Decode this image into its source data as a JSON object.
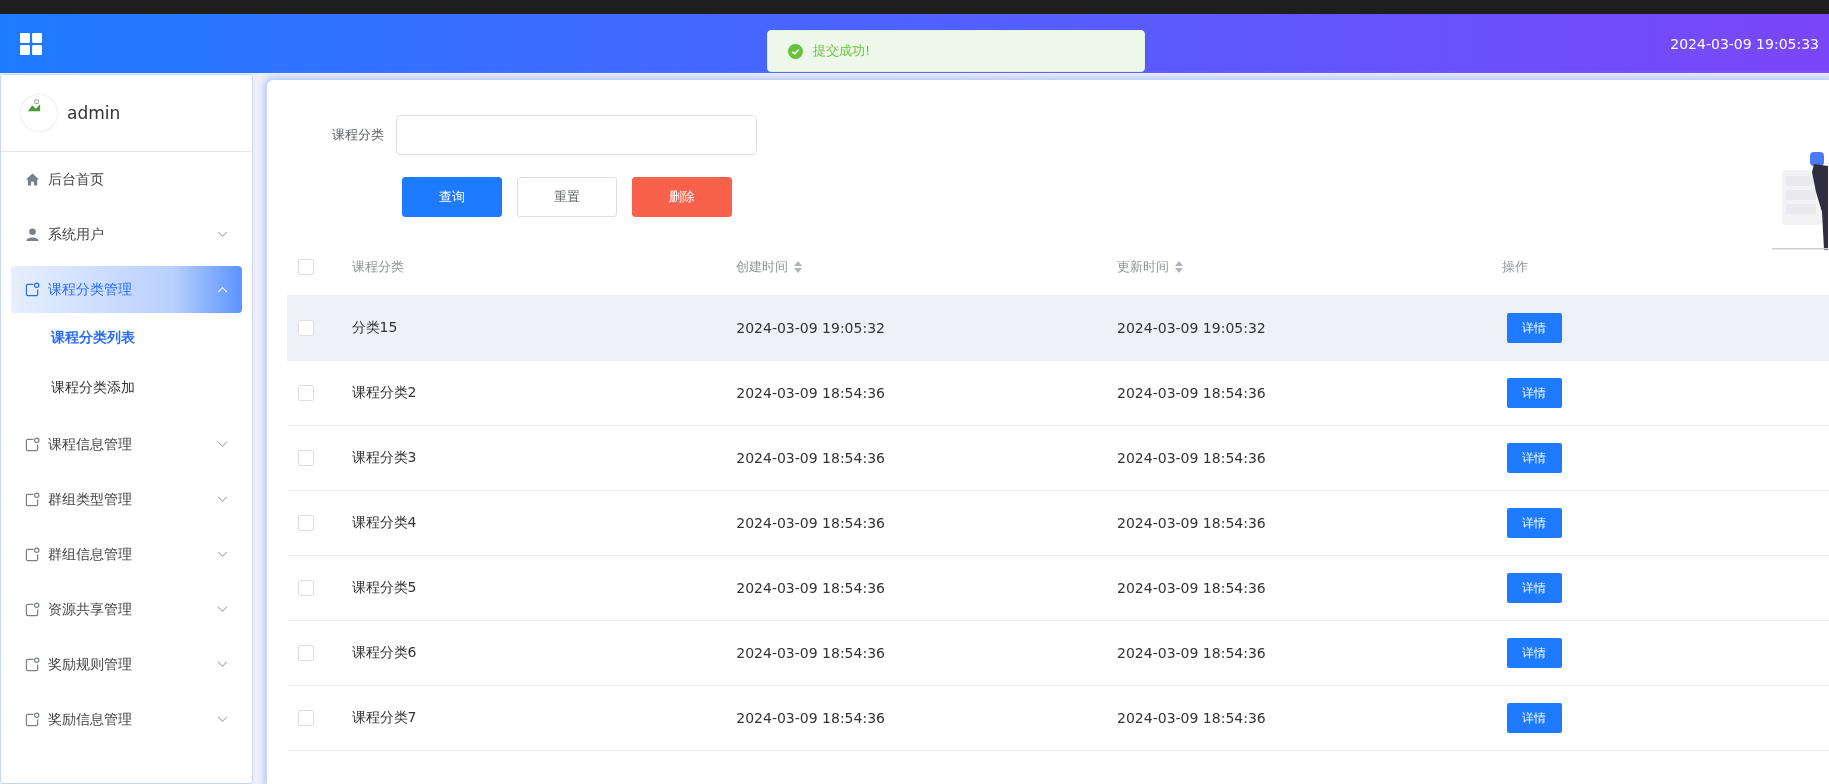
{
  "header": {
    "datetime": "2024-03-09 19:05:33"
  },
  "toast": {
    "kind": "success",
    "message": "提交成功!"
  },
  "user": {
    "name": "admin"
  },
  "sidebar": {
    "items": [
      {
        "kind": "home",
        "label": "后台首页",
        "selected": false
      },
      {
        "kind": "user",
        "label": "系统用户",
        "selected": false,
        "expanded": false
      },
      {
        "kind": "module",
        "label": "课程分类管理",
        "selected": true,
        "expanded": true,
        "children": [
          {
            "label": "课程分类列表",
            "selected": true
          },
          {
            "label": "课程分类添加",
            "selected": false
          }
        ]
      },
      {
        "kind": "module",
        "label": "课程信息管理",
        "selected": false,
        "expanded": false
      },
      {
        "kind": "module",
        "label": "群组类型管理",
        "selected": false,
        "expanded": false
      },
      {
        "kind": "module",
        "label": "群组信息管理",
        "selected": false,
        "expanded": false
      },
      {
        "kind": "module",
        "label": "资源共享管理",
        "selected": false,
        "expanded": false
      },
      {
        "kind": "module",
        "label": "奖励规则管理",
        "selected": false,
        "expanded": false
      },
      {
        "kind": "module",
        "label": "奖励信息管理",
        "selected": false,
        "expanded": false
      }
    ]
  },
  "search": {
    "label": "课程分类"
  },
  "buttons": [
    {
      "kind": "primary",
      "label": "查询"
    },
    {
      "kind": "default",
      "label": "重置"
    },
    {
      "kind": "danger",
      "label": "删除"
    }
  ],
  "table": {
    "header_checked": false,
    "columns": [
      {
        "label": "课程分类",
        "sortable": false
      },
      {
        "label": "创建时间",
        "sortable": true
      },
      {
        "label": "更新时间",
        "sortable": true
      },
      {
        "label": "操作",
        "sortable": false
      }
    ],
    "rows": [
      {
        "checked": false,
        "hovered": true,
        "name": "分类15",
        "created": "2024-03-09 19:05:32",
        "updated": "2024-03-09 19:05:32",
        "action": "详情"
      },
      {
        "checked": false,
        "hovered": false,
        "name": "课程分类2",
        "created": "2024-03-09 18:54:36",
        "updated": "2024-03-09 18:54:36",
        "action": "详情"
      },
      {
        "checked": false,
        "hovered": false,
        "name": "课程分类3",
        "created": "2024-03-09 18:54:36",
        "updated": "2024-03-09 18:54:36",
        "action": "详情"
      },
      {
        "checked": false,
        "hovered": false,
        "name": "课程分类4",
        "created": "2024-03-09 18:54:36",
        "updated": "2024-03-09 18:54:36",
        "action": "详情"
      },
      {
        "checked": false,
        "hovered": false,
        "name": "课程分类5",
        "created": "2024-03-09 18:54:36",
        "updated": "2024-03-09 18:54:36",
        "action": "详情"
      },
      {
        "checked": false,
        "hovered": false,
        "name": "课程分类6",
        "created": "2024-03-09 18:54:36",
        "updated": "2024-03-09 18:54:36",
        "action": "详情"
      },
      {
        "checked": false,
        "hovered": false,
        "name": "课程分类7",
        "created": "2024-03-09 18:54:36",
        "updated": "2024-03-09 18:54:36",
        "action": "详情"
      }
    ]
  }
}
